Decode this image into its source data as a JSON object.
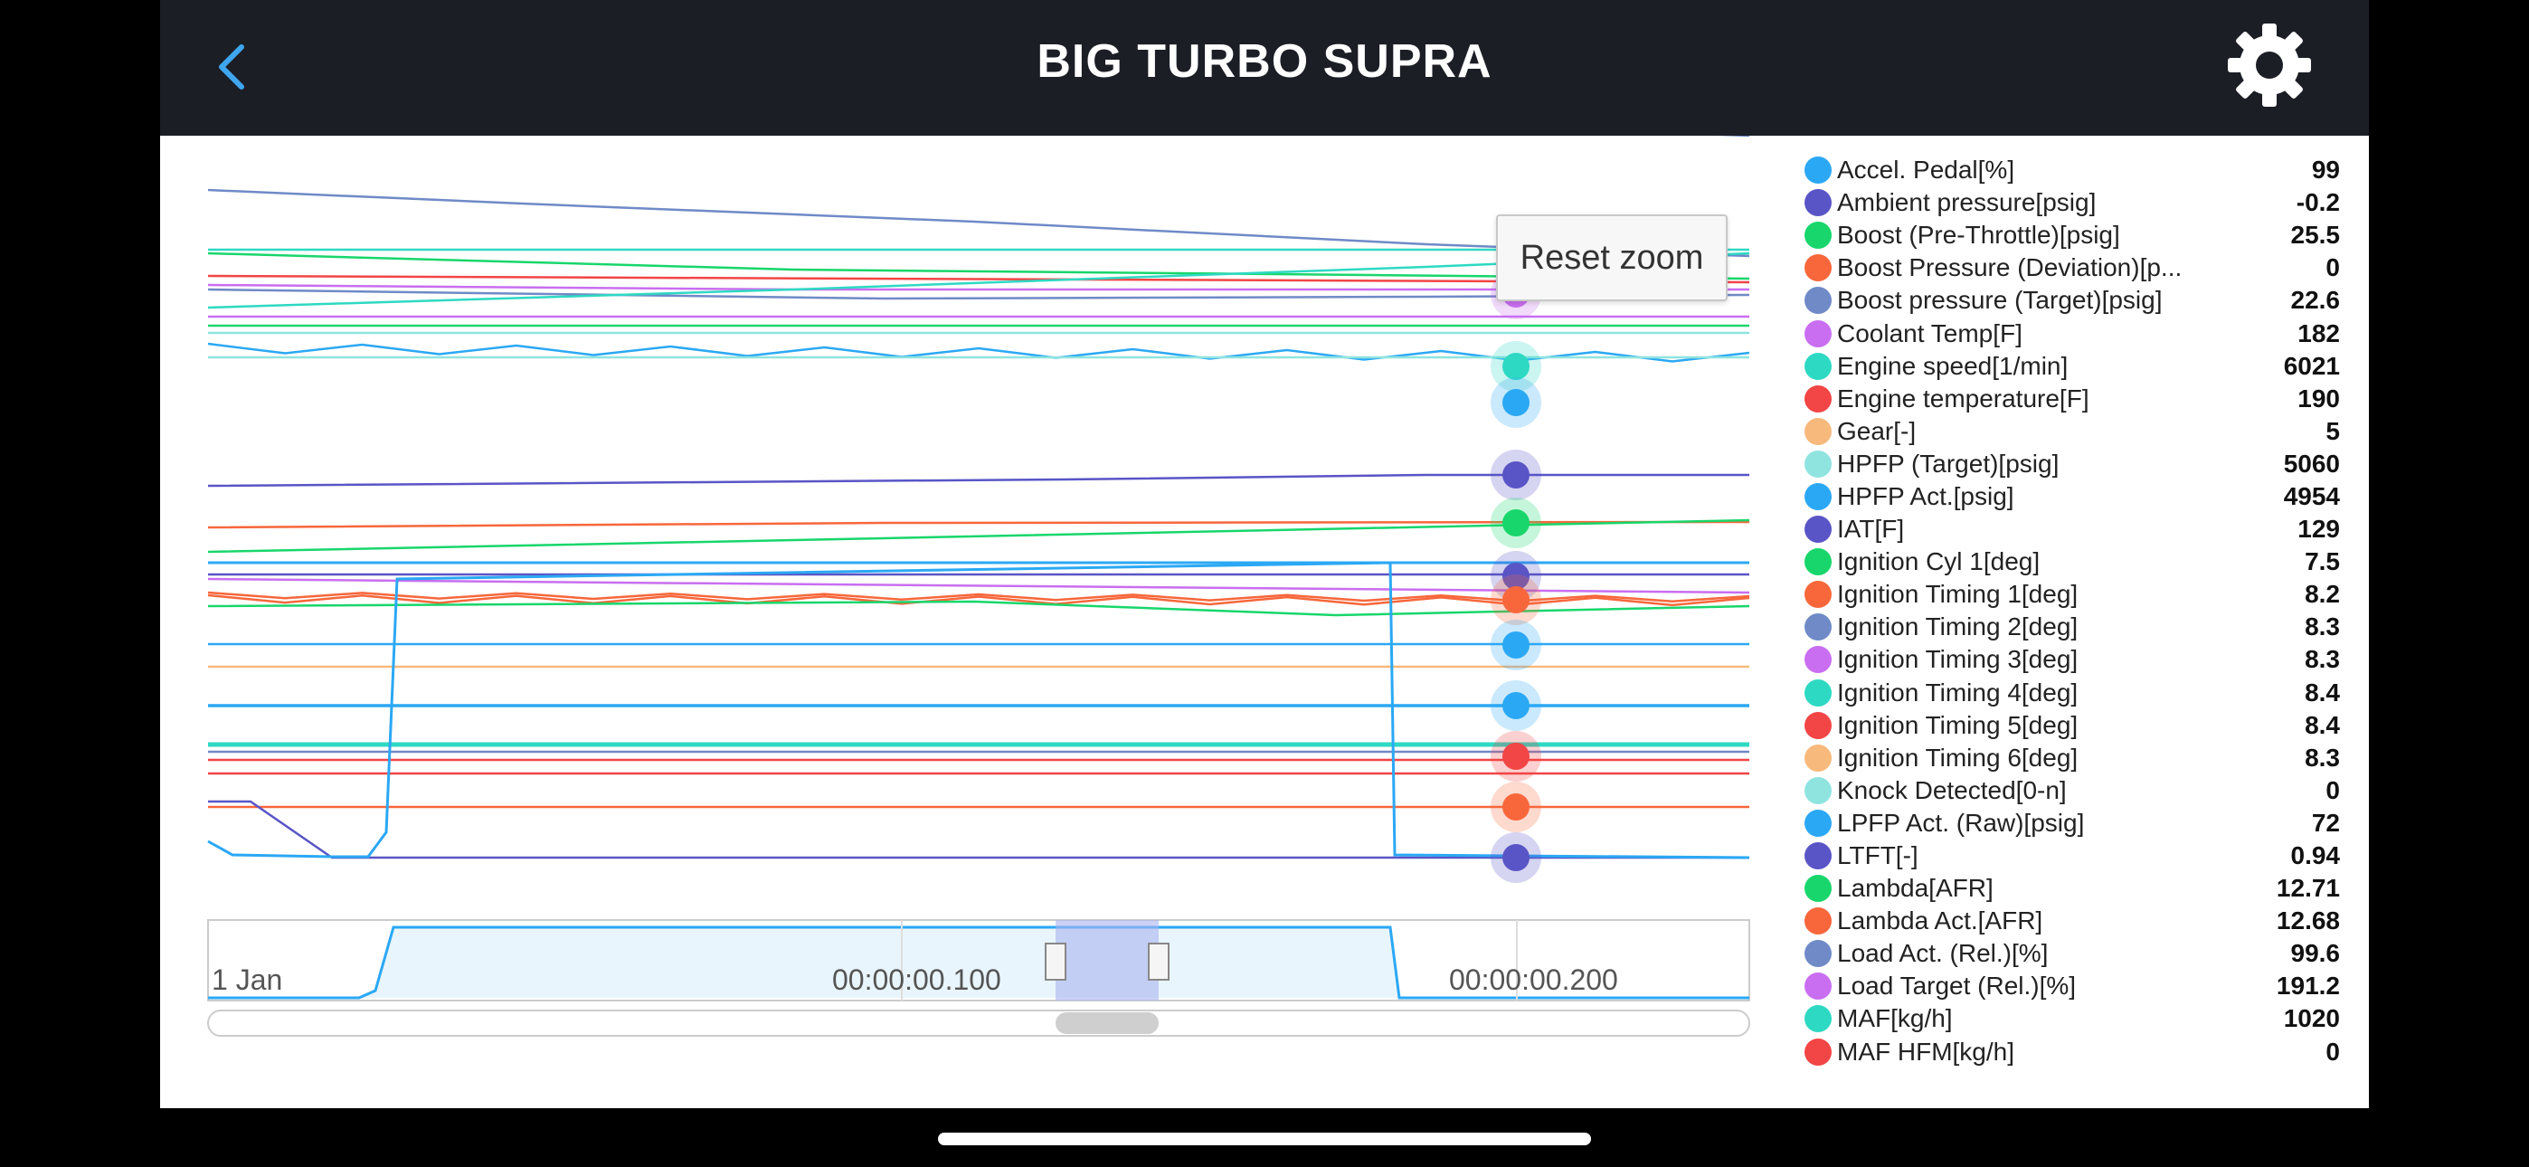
{
  "header": {
    "title": "BIG TURBO SUPRA",
    "back_icon": "chevron-left-icon",
    "settings_icon": "gear-icon",
    "back_color": "#3ea6ee"
  },
  "reset_zoom_label": "Reset zoom",
  "navigator": {
    "labels": [
      "1 Jan",
      "00:00:00.100",
      "00:00:00.200"
    ]
  },
  "legend": [
    {
      "name": "Accel. Pedal[%]",
      "value": "99",
      "color": "#2ba8f4"
    },
    {
      "name": "Ambient pressure[psig]",
      "value": "-0.2",
      "color": "#5955c6"
    },
    {
      "name": "Boost (Pre-Throttle)[psig]",
      "value": "25.5",
      "color": "#18d66b"
    },
    {
      "name": "Boost Pressure (Deviation)[p...",
      "value": "0",
      "color": "#f7673b"
    },
    {
      "name": "Boost pressure (Target)[psig]",
      "value": "22.6",
      "color": "#6f8ac7"
    },
    {
      "name": "Coolant Temp[F]",
      "value": "182",
      "color": "#c96ef0"
    },
    {
      "name": "Engine speed[1/min]",
      "value": "6021",
      "color": "#2ed9c3"
    },
    {
      "name": "Engine temperature[F]",
      "value": "190",
      "color": "#f24545"
    },
    {
      "name": "Gear[-]",
      "value": "5",
      "color": "#f8b97c"
    },
    {
      "name": "HPFP (Target)[psig]",
      "value": "5060",
      "color": "#8fe4e0"
    },
    {
      "name": "HPFP Act.[psig]",
      "value": "4954",
      "color": "#2ba8f4"
    },
    {
      "name": "IAT[F]",
      "value": "129",
      "color": "#5955c6"
    },
    {
      "name": "Ignition Cyl 1[deg]",
      "value": "7.5",
      "color": "#18d66b"
    },
    {
      "name": "Ignition Timing 1[deg]",
      "value": "8.2",
      "color": "#f7673b"
    },
    {
      "name": "Ignition Timing 2[deg]",
      "value": "8.3",
      "color": "#6f8ac7"
    },
    {
      "name": "Ignition Timing 3[deg]",
      "value": "8.3",
      "color": "#c96ef0"
    },
    {
      "name": "Ignition Timing 4[deg]",
      "value": "8.4",
      "color": "#2ed9c3"
    },
    {
      "name": "Ignition Timing 5[deg]",
      "value": "8.4",
      "color": "#f24545"
    },
    {
      "name": "Ignition Timing 6[deg]",
      "value": "8.3",
      "color": "#f8b97c"
    },
    {
      "name": "Knock Detected[0-n]",
      "value": "0",
      "color": "#8fe4e0"
    },
    {
      "name": "LPFP Act. (Raw)[psig]",
      "value": "72",
      "color": "#2ba8f4"
    },
    {
      "name": "LTFT[-]",
      "value": "0.94",
      "color": "#5955c6"
    },
    {
      "name": "Lambda[AFR]",
      "value": "12.71",
      "color": "#18d66b"
    },
    {
      "name": "Lambda Act.[AFR]",
      "value": "12.68",
      "color": "#f7673b"
    },
    {
      "name": "Load Act. (Rel.)[%]",
      "value": "99.6",
      "color": "#6f8ac7"
    },
    {
      "name": "Load Target (Rel.)[%]",
      "value": "191.2",
      "color": "#c96ef0"
    },
    {
      "name": "MAF[kg/h]",
      "value": "1020",
      "color": "#2ed9c3"
    },
    {
      "name": "MAF HFM[kg/h]",
      "value": "0",
      "color": "#f24545"
    }
  ]
}
